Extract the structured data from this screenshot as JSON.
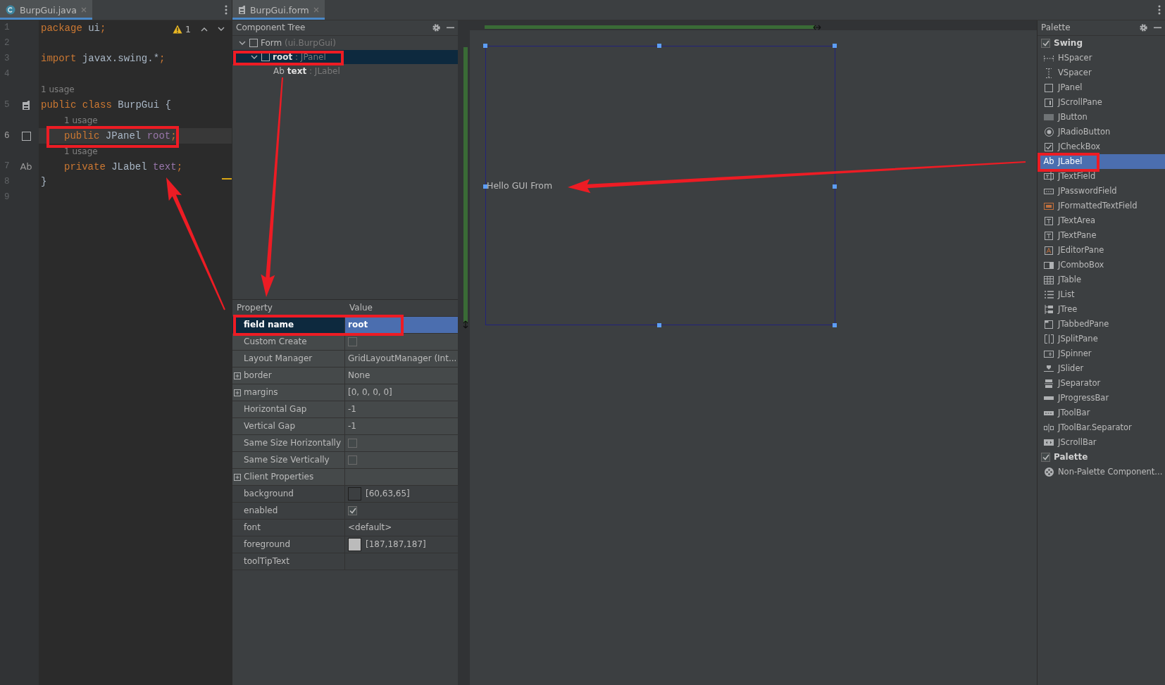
{
  "editor": {
    "tab": {
      "label": "BurpGui.java",
      "selected": true
    },
    "warning_count": "1",
    "lines": [
      {
        "kind": "code",
        "number": "1",
        "current": false,
        "indented": false,
        "tokens": [
          {
            "kind": "keyword",
            "text": "package"
          },
          {
            "kind": "plain",
            "text": " ui"
          },
          {
            "kind": "keyword",
            "text": ";"
          }
        ]
      },
      {
        "kind": "code",
        "number": "2",
        "current": false
      },
      {
        "kind": "code",
        "number": "3",
        "current": false,
        "indented": false,
        "tokens": [
          {
            "kind": "keyword",
            "text": "import"
          },
          {
            "kind": "plain",
            "text": " javax.swing.*"
          },
          {
            "kind": "keyword",
            "text": ";"
          }
        ]
      },
      {
        "kind": "code",
        "number": "4",
        "current": false
      },
      {
        "kind": "hint",
        "text": "1 usage",
        "indented": false
      },
      {
        "kind": "code",
        "number": "5",
        "current": false,
        "indented": false,
        "marker": {
          "kind": "form"
        },
        "tokens": [
          {
            "kind": "keyword",
            "text": "public class"
          },
          {
            "kind": "plain",
            "text": " BurpGui {"
          }
        ]
      },
      {
        "kind": "hint",
        "text": "1 usage",
        "indented": true
      },
      {
        "kind": "code",
        "number": "6",
        "current": true,
        "indented": true,
        "marker": {
          "kind": "panel"
        },
        "tokens": [
          {
            "kind": "keyword",
            "text": "public"
          },
          {
            "kind": "plain",
            "text": " JPanel "
          },
          {
            "kind": "field",
            "text": "root"
          },
          {
            "kind": "keyword",
            "text": ";"
          }
        ]
      },
      {
        "kind": "hint",
        "text": "1 usage",
        "indented": true
      },
      {
        "kind": "code",
        "number": "7",
        "current": false,
        "indented": true,
        "marker": {
          "kind": "glyph",
          "text": "Ab"
        },
        "tokens": [
          {
            "kind": "keyword",
            "text": "private"
          },
          {
            "kind": "plain",
            "text": " JLabel "
          },
          {
            "kind": "field",
            "text": "text"
          },
          {
            "kind": "keyword",
            "text": ";"
          }
        ]
      },
      {
        "kind": "code",
        "number": "8",
        "current": false,
        "indented": false,
        "tokens": [
          {
            "kind": "plain",
            "text": "}"
          }
        ]
      },
      {
        "kind": "code",
        "number": "9",
        "current": false
      }
    ]
  },
  "form_tab": {
    "label": "BurpGui.form",
    "selected": true
  },
  "component_tree": {
    "title": "Component Tree",
    "nodes": [
      {
        "kind": "form",
        "label": "Form",
        "type_text": "(ui.BurpGui)",
        "expanded": true,
        "selected": false,
        "children": [
          {
            "kind": "component",
            "label": "root",
            "type_text": ": JPanel",
            "expanded": true,
            "selected": true,
            "children": [
              {
                "kind": "component",
                "glyph": "Ab",
                "label": "text",
                "type_text": ": JLabel",
                "selected": false
              }
            ]
          }
        ]
      }
    ]
  },
  "properties": {
    "columns": [
      "Property",
      "Value"
    ],
    "groups": [
      {
        "kind": "layout",
        "rows": [
          {
            "name": "field name",
            "kind": "text",
            "value": "root",
            "expandable": false,
            "selected": true
          },
          {
            "name": "Custom Create",
            "kind": "checkbox",
            "checked": false,
            "expandable": false,
            "selected": false
          },
          {
            "name": "Layout Manager",
            "kind": "text",
            "value": "GridLayoutManager (Int...",
            "expandable": false,
            "selected": false
          },
          {
            "name": "border",
            "kind": "text",
            "value": "None",
            "expandable": true,
            "selected": false
          },
          {
            "name": "margins",
            "kind": "text",
            "value": "[0, 0, 0, 0]",
            "expandable": true,
            "selected": false
          },
          {
            "name": "Horizontal Gap",
            "kind": "text",
            "value": "-1",
            "expandable": false,
            "selected": false
          },
          {
            "name": "Vertical Gap",
            "kind": "text",
            "value": "-1",
            "expandable": false,
            "selected": false
          },
          {
            "name": "Same Size Horizontally",
            "kind": "checkbox",
            "checked": false,
            "expandable": false,
            "selected": false
          },
          {
            "name": "Same Size Vertically",
            "kind": "checkbox",
            "checked": false,
            "expandable": false,
            "selected": false
          },
          {
            "name": "Client Properties",
            "kind": "empty",
            "expandable": true,
            "selected": false
          }
        ]
      },
      {
        "kind": "component",
        "rows": [
          {
            "name": "background",
            "kind": "color",
            "color": "#3c3f41",
            "value": "[60,63,65]",
            "expandable": false,
            "selected": false
          },
          {
            "name": "enabled",
            "kind": "checkbox",
            "checked": true,
            "expandable": false,
            "selected": false
          },
          {
            "name": "font",
            "kind": "text",
            "value": "<default>",
            "expandable": false,
            "selected": false
          },
          {
            "name": "foreground",
            "kind": "color",
            "color": "#bbbbbb",
            "value": "[187,187,187]",
            "expandable": false,
            "selected": false
          },
          {
            "name": "toolTipText",
            "kind": "empty",
            "expandable": false,
            "selected": false
          }
        ]
      }
    ]
  },
  "canvas": {
    "label": "Hello GUI From"
  },
  "palette": {
    "title": "Palette",
    "groups": [
      {
        "label": "Swing",
        "checked": true,
        "items": [
          {
            "label": "HSpacer",
            "kind": "hspacer",
            "selected": false
          },
          {
            "label": "VSpacer",
            "kind": "vspacer",
            "selected": false
          },
          {
            "label": "JPanel",
            "kind": "panel",
            "selected": false
          },
          {
            "label": "JScrollPane",
            "kind": "scrollpane",
            "selected": false
          },
          {
            "label": "JButton",
            "kind": "button",
            "selected": false
          },
          {
            "label": "JRadioButton",
            "kind": "radio",
            "selected": false
          },
          {
            "label": "JCheckBox",
            "kind": "checkbox",
            "selected": false
          },
          {
            "label": "JLabel",
            "kind": "label",
            "glyph": "Ab",
            "selected": true
          },
          {
            "label": "JTextField",
            "kind": "textfield",
            "selected": false
          },
          {
            "label": "JPasswordField",
            "kind": "password",
            "selected": false
          },
          {
            "label": "JFormattedTextField",
            "kind": "formatted",
            "selected": false
          },
          {
            "label": "JTextArea",
            "kind": "textarea",
            "selected": false
          },
          {
            "label": "JTextPane",
            "kind": "textarea",
            "selected": false
          },
          {
            "label": "JEditorPane",
            "kind": "editorpane",
            "selected": false
          },
          {
            "label": "JComboBox",
            "kind": "combobox",
            "selected": false
          },
          {
            "label": "JTable",
            "kind": "table",
            "selected": false
          },
          {
            "label": "JList",
            "kind": "list",
            "selected": false
          },
          {
            "label": "JTree",
            "kind": "tree",
            "selected": false
          },
          {
            "label": "JTabbedPane",
            "kind": "tabbed",
            "selected": false
          },
          {
            "label": "JSplitPane",
            "kind": "split",
            "selected": false
          },
          {
            "label": "JSpinner",
            "kind": "spinner",
            "selected": false
          },
          {
            "label": "JSlider",
            "kind": "slider",
            "selected": false
          },
          {
            "label": "JSeparator",
            "kind": "separator",
            "selected": false
          },
          {
            "label": "JProgressBar",
            "kind": "progress",
            "selected": false
          },
          {
            "label": "JToolBar",
            "kind": "toolbar",
            "selected": false
          },
          {
            "label": "JToolBar.Separator",
            "kind": "toolbarsep",
            "selected": false
          },
          {
            "label": "JScrollBar",
            "kind": "scrollbar",
            "selected": false
          }
        ]
      },
      {
        "label": "Palette",
        "checked": true,
        "items": [
          {
            "label": "Non-Palette Component...",
            "kind": "nonpalette",
            "selected": false
          }
        ]
      }
    ]
  }
}
